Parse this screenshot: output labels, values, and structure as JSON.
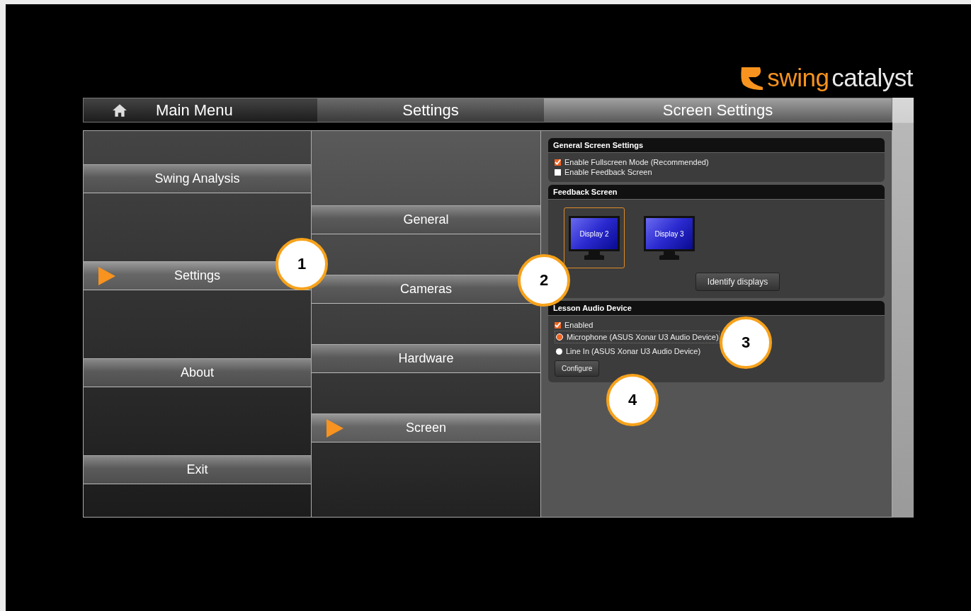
{
  "logo": {
    "part_1": "swing",
    "part_2": "catalyst"
  },
  "breadcrumb": [
    {
      "label": "Main Menu",
      "home": true
    },
    {
      "label": "Settings",
      "home": false
    },
    {
      "label": "Screen Settings",
      "home": false
    }
  ],
  "main_menu": [
    {
      "label": "Swing Analysis",
      "selected": false
    },
    {
      "label": "Settings",
      "selected": true
    },
    {
      "label": "About",
      "selected": false
    },
    {
      "label": "Exit",
      "selected": false
    }
  ],
  "settings_menu": [
    {
      "label": "General",
      "selected": false
    },
    {
      "label": "Cameras",
      "selected": false
    },
    {
      "label": "Hardware",
      "selected": false
    },
    {
      "label": "Screen",
      "selected": true
    }
  ],
  "general_screen_settings": {
    "title": "General Screen Settings",
    "options": [
      {
        "label": "Enable Fullscreen Mode (Recommended)",
        "checked": true
      },
      {
        "label": "Enable Feedback Screen",
        "checked": false
      }
    ]
  },
  "feedback_screen": {
    "title": "Feedback Screen",
    "displays": [
      {
        "label": "Display 2",
        "selected": true
      },
      {
        "label": "Display 3",
        "selected": false
      }
    ],
    "button": "Identify displays"
  },
  "lesson_audio_device": {
    "title": "Lesson Audio Device",
    "enabled": {
      "label": "Enabled",
      "checked": true
    },
    "devices": [
      {
        "label": "Microphone (ASUS Xonar U3 Audio Device)",
        "selected": true
      },
      {
        "label": "Line In (ASUS Xonar U3 Audio Device)",
        "selected": false
      }
    ],
    "button": "Configure"
  },
  "callouts": [
    "1",
    "2",
    "3",
    "4"
  ]
}
